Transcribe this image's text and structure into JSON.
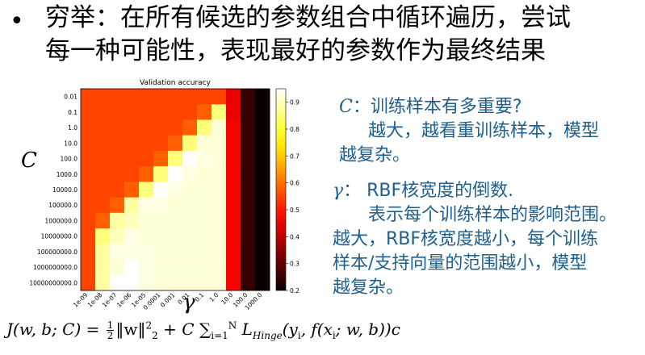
{
  "bullet": {
    "line1": "穷举：在所有候选的参数组合中循环遍历，尝试",
    "line2": "每一种可能性，表现最好的参数作为最终结果"
  },
  "chart_data": {
    "type": "heatmap",
    "title": "Validation accuracy",
    "xlabel": "γ",
    "ylabel": "C",
    "x_ticks": [
      "1e-09",
      "1e-08",
      "1e-07",
      "1e-06",
      "1e-05",
      "0.0001",
      "0.001",
      "0.01",
      "0.1",
      "1.0",
      "10.0",
      "100.0",
      "1000.0"
    ],
    "y_ticks": [
      "0.01",
      "0.1",
      "1.0",
      "10.0",
      "100.0",
      "1000.0",
      "10000.0",
      "100000.0",
      "1000000.0",
      "10000000.0",
      "100000000.0",
      "1000000000.0",
      "10000000000.0"
    ],
    "colorbar_ticks": [
      "0.9",
      "0.8",
      "0.7",
      "0.6",
      "0.5",
      "0.4",
      "0.3",
      "0.2"
    ],
    "vmin": 0.2,
    "vmax": 0.95,
    "values": [
      [
        0.55,
        0.55,
        0.55,
        0.55,
        0.55,
        0.55,
        0.55,
        0.55,
        0.55,
        0.55,
        0.45,
        0.25,
        0.2
      ],
      [
        0.55,
        0.55,
        0.55,
        0.55,
        0.55,
        0.55,
        0.55,
        0.55,
        0.58,
        0.85,
        0.45,
        0.25,
        0.2
      ],
      [
        0.55,
        0.55,
        0.55,
        0.55,
        0.55,
        0.55,
        0.55,
        0.58,
        0.85,
        0.92,
        0.47,
        0.25,
        0.2
      ],
      [
        0.55,
        0.55,
        0.55,
        0.55,
        0.55,
        0.55,
        0.58,
        0.85,
        0.92,
        0.92,
        0.47,
        0.25,
        0.2
      ],
      [
        0.55,
        0.55,
        0.55,
        0.55,
        0.55,
        0.58,
        0.85,
        0.95,
        0.93,
        0.92,
        0.47,
        0.25,
        0.2
      ],
      [
        0.55,
        0.55,
        0.55,
        0.55,
        0.58,
        0.85,
        0.95,
        0.93,
        0.92,
        0.92,
        0.47,
        0.25,
        0.2
      ],
      [
        0.55,
        0.55,
        0.55,
        0.58,
        0.85,
        0.95,
        0.93,
        0.92,
        0.92,
        0.92,
        0.47,
        0.25,
        0.2
      ],
      [
        0.55,
        0.55,
        0.58,
        0.88,
        0.93,
        0.93,
        0.92,
        0.92,
        0.92,
        0.92,
        0.47,
        0.25,
        0.2
      ],
      [
        0.55,
        0.58,
        0.88,
        0.9,
        0.92,
        0.92,
        0.92,
        0.92,
        0.92,
        0.92,
        0.47,
        0.25,
        0.2
      ],
      [
        0.55,
        0.85,
        0.9,
        0.93,
        0.92,
        0.92,
        0.92,
        0.92,
        0.92,
        0.92,
        0.47,
        0.25,
        0.2
      ],
      [
        0.55,
        0.88,
        0.93,
        0.93,
        0.93,
        0.92,
        0.92,
        0.92,
        0.92,
        0.92,
        0.47,
        0.25,
        0.2
      ],
      [
        0.55,
        0.88,
        0.92,
        0.95,
        0.93,
        0.92,
        0.92,
        0.92,
        0.92,
        0.92,
        0.47,
        0.25,
        0.2
      ],
      [
        0.55,
        0.88,
        0.95,
        0.95,
        0.93,
        0.92,
        0.92,
        0.92,
        0.92,
        0.92,
        0.47,
        0.25,
        0.2
      ]
    ]
  },
  "axis_titles": {
    "c": "C",
    "gamma": "γ"
  },
  "note_c": {
    "sym": "C",
    "line1": "：训练样本有多重要?",
    "line2": "越大，越看重训练样本，模型",
    "line3": "越复杂。"
  },
  "note_gamma": {
    "sym": "γ",
    "line1": "：  RBF核宽度的倒数.",
    "line2": "表示每个训练样本的影响范围。",
    "line3": "越大，RBF核宽度越小，每个训练",
    "line4": "样本/支持向量的范围越小，模型",
    "line5": "越复杂。"
  },
  "formula": {
    "lhs": "J(w, b; C) =",
    "frac_num": "1",
    "frac_den": "2",
    "norm": "‖w‖",
    "sup2": "2",
    "sub2": "2",
    "plus_c": "+ C ∑",
    "sum_sub": "i=1",
    "sum_sup": "N",
    "loss": "L",
    "loss_sub": "Hinge",
    "args": "(y",
    "args_sub": "i",
    "args2": ", f(x",
    "args2_sub": "i",
    "args3": "; w, b))c"
  }
}
